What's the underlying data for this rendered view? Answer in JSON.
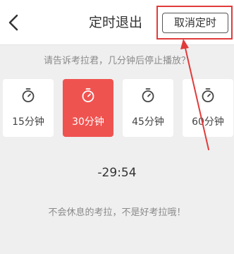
{
  "header": {
    "back_icon": "chevron-left-icon",
    "title": "定时退出",
    "cancel_label": "取消定时"
  },
  "prompt": "请告诉考拉君，几分钟后停止播放？",
  "options": [
    {
      "label": "15分钟",
      "icon": "timer-icon",
      "selected": false
    },
    {
      "label": "30分钟",
      "icon": "timer-icon",
      "selected": true
    },
    {
      "label": "45分钟",
      "icon": "timer-icon",
      "selected": false
    },
    {
      "label": "60分钟",
      "icon": "timer-icon",
      "selected": false
    }
  ],
  "countdown": "-29:54",
  "footer_note": "不会休息的考拉，不是好考拉哦！",
  "colors": {
    "accent": "#ef5350",
    "annotation": "#e13b3b",
    "background": "#efefef"
  }
}
